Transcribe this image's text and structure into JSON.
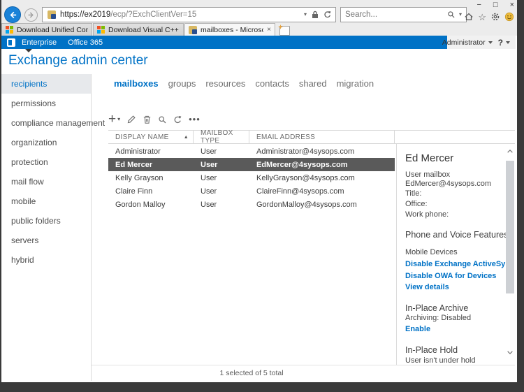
{
  "browser": {
    "window_controls": {
      "minimize": "−",
      "maximize": "□",
      "close": "×"
    },
    "url_domain": "https://ex2019",
    "url_path": "/ecp/?ExchClientVer=15",
    "search_placeholder": "Search...",
    "tabs": [
      {
        "title": "Download Unified Communic...",
        "active": false
      },
      {
        "title": "Download Visual C++ Redistri...",
        "active": false
      },
      {
        "title": "mailboxes - Microsoft Exch...",
        "active": true,
        "close_label": "×"
      }
    ],
    "icons": [
      "home-icon",
      "favorites-star-icon",
      "settings-gear-icon",
      "feedback-smiley-icon"
    ]
  },
  "topbar": {
    "brand_left": "Enterprise",
    "brand_right": "Office 365",
    "user": "Administrator",
    "help": "?"
  },
  "page": {
    "title": "Exchange admin center"
  },
  "sidebar": {
    "items": [
      {
        "label": "recipients",
        "selected": true
      },
      {
        "label": "permissions"
      },
      {
        "label": "compliance management"
      },
      {
        "label": "organization"
      },
      {
        "label": "protection"
      },
      {
        "label": "mail flow"
      },
      {
        "label": "mobile"
      },
      {
        "label": "public folders"
      },
      {
        "label": "servers"
      },
      {
        "label": "hybrid"
      }
    ]
  },
  "content_tabs": [
    {
      "label": "mailboxes",
      "active": true
    },
    {
      "label": "groups"
    },
    {
      "label": "resources"
    },
    {
      "label": "contacts"
    },
    {
      "label": "shared"
    },
    {
      "label": "migration"
    }
  ],
  "toolbar": {
    "icons": [
      "new",
      "new-dropdown",
      "edit",
      "delete",
      "search",
      "refresh",
      "more"
    ],
    "more_label": "•••",
    "sort_indicator": "▲"
  },
  "table": {
    "columns": [
      "DISPLAY NAME",
      "MAILBOX TYPE",
      "EMAIL ADDRESS"
    ],
    "rows": [
      {
        "display_name": "Administrator",
        "mailbox_type": "User",
        "email": "Administrator@4sysops.com",
        "selected": false
      },
      {
        "display_name": "Ed Mercer",
        "mailbox_type": "User",
        "email": "EdMercer@4sysops.com",
        "selected": true
      },
      {
        "display_name": "Kelly Grayson",
        "mailbox_type": "User",
        "email": "KellyGrayson@4sysops.com",
        "selected": false
      },
      {
        "display_name": "Claire Finn",
        "mailbox_type": "User",
        "email": "ClaireFinn@4sysops.com",
        "selected": false
      },
      {
        "display_name": "Gordon Malloy",
        "mailbox_type": "User",
        "email": "GordonMalloy@4sysops.com",
        "selected": false
      }
    ],
    "status": "1 selected of 5 total"
  },
  "details": {
    "title": "Ed Mercer",
    "type_line": "User mailbox",
    "email": "EdMercer@4sysops.com",
    "field_title": "Title:",
    "field_office": "Office:",
    "field_work_phone": "Work phone:",
    "phone_section_heading": "Phone and Voice Features",
    "mobile_devices_label": "Mobile Devices",
    "link_disable_activesync": "Disable Exchange ActiveSync",
    "link_disable_owa": "Disable OWA for Devices",
    "link_view_details": "View details",
    "archive_heading": "In-Place Archive",
    "archive_status": "Archiving:  Disabled",
    "link_enable": "Enable",
    "hold_heading": "In-Place Hold",
    "hold_status": "User isn't under hold"
  },
  "colors": {
    "accent_blue": "#0072c6",
    "selected_row": "#5a5a5a",
    "chrome_gray": "#ececec",
    "link_blue": "#0072c6"
  }
}
